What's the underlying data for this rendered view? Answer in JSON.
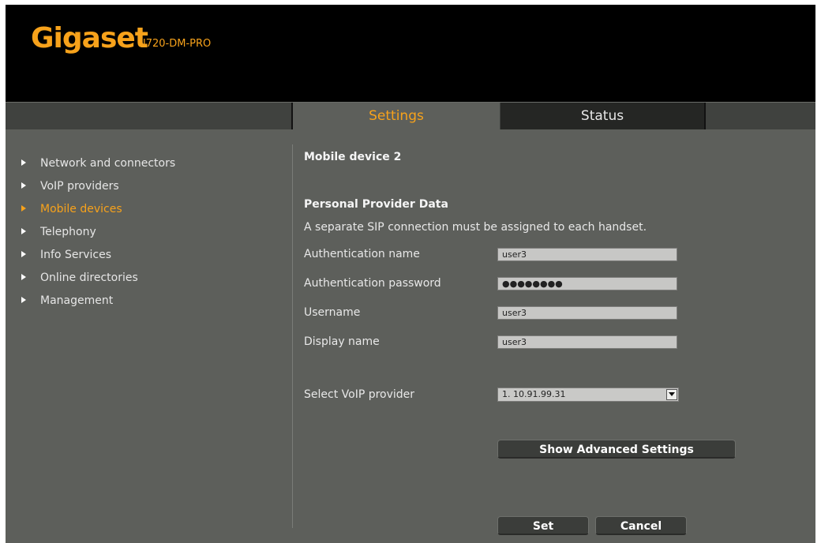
{
  "header": {
    "brand": "Gigaset",
    "model": "N720-DM-PRO"
  },
  "tabs": [
    {
      "label": "Settings",
      "active": true
    },
    {
      "label": "Status",
      "active": false
    }
  ],
  "sidebar": {
    "items": [
      {
        "label": "Network and connectors"
      },
      {
        "label": "VoIP providers"
      },
      {
        "label": "Mobile devices",
        "active": true
      },
      {
        "label": "Telephony"
      },
      {
        "label": "Info Services"
      },
      {
        "label": "Online directories"
      },
      {
        "label": "Management"
      }
    ]
  },
  "main": {
    "title": "Mobile device 2",
    "section_title": "Personal Provider Data",
    "note": "A separate SIP connection must be assigned to each handset.",
    "fields": {
      "auth_name": {
        "label": "Authentication name",
        "value": "user3"
      },
      "auth_password": {
        "label": "Authentication password",
        "value": "●●●●●●●●"
      },
      "username": {
        "label": "Username",
        "value": "user3"
      },
      "display_name": {
        "label": "Display name",
        "value": "user3"
      }
    },
    "voip_provider": {
      "label": "Select VoIP provider",
      "selected": "1. 10.91.99.31"
    },
    "advanced_button": "Show Advanced Settings",
    "set_button": "Set",
    "cancel_button": "Cancel"
  },
  "colors": {
    "accent": "#f7a21b",
    "background": "#5d5f5b",
    "header": "#000000"
  }
}
